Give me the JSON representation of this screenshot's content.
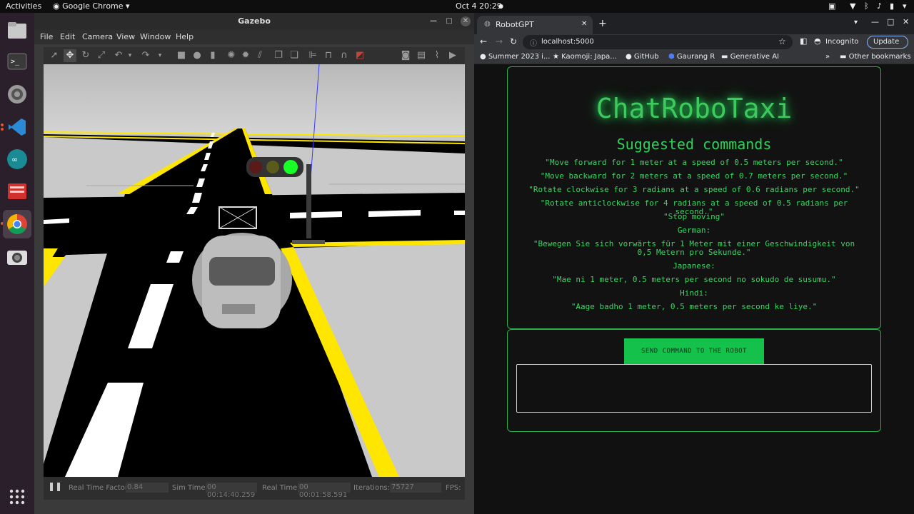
{
  "topbar": {
    "activities": "Activities",
    "app": "Google Chrome",
    "clock": "Oct 4  20:29"
  },
  "dock": {
    "items": [
      "files-icon",
      "terminal-icon",
      "settings-icon",
      "vscode-icon",
      "arduino-icon",
      "app-icon",
      "chrome-icon",
      "camera-icon"
    ],
    "apps_grid": "show-applications-icon"
  },
  "gazebo": {
    "title": "Gazebo",
    "menu": [
      "File",
      "Edit",
      "Camera",
      "View",
      "Window",
      "Help"
    ],
    "status": {
      "rtf_label": "Real Time Factor:",
      "rtf": "0.84",
      "sim_label": "Sim Time:",
      "sim": "00 00:14:40.259",
      "real_label": "Real Time:",
      "real": "00 00:01:58.591",
      "iter_label": "Iterations:",
      "iter": "75727",
      "fps_label": "FPS:"
    }
  },
  "chrome": {
    "tab_title": "RobotGPT",
    "url": "localhost:5000",
    "incognito": "Incognito",
    "update": "Update",
    "bookmarks": [
      "Summer 2023 i...",
      "Kaomoji: Japa...",
      "GitHub",
      "Gaurang R",
      "Generative AI"
    ],
    "other_bookmarks": "Other bookmarks"
  },
  "app": {
    "title": "ChatRoboTaxi",
    "subtitle": "Suggested commands",
    "commands": [
      "\"Move forward for 1 meter at a speed of 0.5 meters per second.\"",
      "\"Move backward for 2 meters at a speed of 0.7 meters per second.\"",
      "\"Rotate clockwise for 3 radians at a speed of 0.6 radians per second.\"",
      "\"Rotate anticlockwise for 4 radians at a speed of 0.5 radians per second.\"",
      "\"Stop moving\"",
      "German:",
      "\"Bewegen Sie sich vorwärts für 1 Meter mit einer Geschwindigkeit von 0,5 Metern pro Sekunde.\"",
      "Japanese:",
      "\"Mae ni 1 meter, 0.5 meters per second no sokudo de susumu.\"",
      "Hindi:",
      "\"Aage badho 1 meter, 0.5 meters per second ke liye.\""
    ],
    "send_button": "SEND COMMAND TO THE ROBOT",
    "input_value": ""
  }
}
